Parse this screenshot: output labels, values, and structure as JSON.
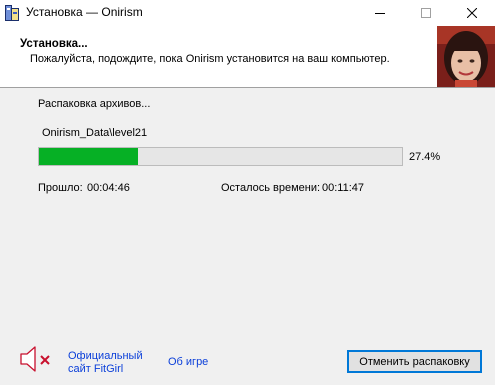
{
  "window": {
    "title": "Установка — Onirism"
  },
  "header": {
    "title": "Установка...",
    "subtitle": "Пожалуйста, подождите, пока Onirism установится на ваш компьютер."
  },
  "main": {
    "status_text": "Распаковка архивов...",
    "current_file": "Onirism_Data\\level21",
    "progress_fraction": 0.274,
    "progress_label": "27.4%",
    "elapsed_label": "Прошло:",
    "elapsed_value": "00:04:46",
    "remaining_label": "Осталось времени:",
    "remaining_value": "00:11:47"
  },
  "footer": {
    "speaker_icon": "speaker-muted-icon",
    "official_site_line1": "Официальный",
    "official_site_line2": "сайт FitGirl",
    "about_game": "Об игре",
    "cancel_button": "Отменить распаковку"
  },
  "colors": {
    "progress_fill": "#06b025",
    "link": "#0b3fd9",
    "mute_x": "#c8102e"
  }
}
